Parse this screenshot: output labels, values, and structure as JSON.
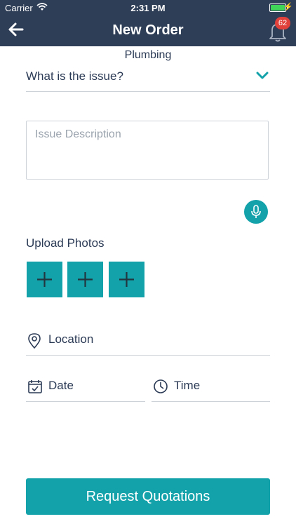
{
  "status_bar": {
    "carrier": "Carrier",
    "time": "2:31 PM"
  },
  "header": {
    "title": "New Order",
    "notification_count": "62",
    "back_icon": "arrow-left-icon",
    "bell_icon": "bell-icon"
  },
  "category": "Plumbing",
  "issue_select": {
    "label": "What is the issue?",
    "icon": "chevron-down-icon"
  },
  "description": {
    "placeholder": "Issue Description",
    "value": ""
  },
  "mic": {
    "icon": "microphone-icon"
  },
  "upload": {
    "title": "Upload Photos",
    "slots": [
      "add-photo-1",
      "add-photo-2",
      "add-photo-3"
    ]
  },
  "location": {
    "label": "Location",
    "icon": "location-pin-icon"
  },
  "date": {
    "label": "Date",
    "icon": "calendar-icon"
  },
  "time": {
    "label": "Time",
    "icon": "clock-icon"
  },
  "cta": {
    "label": "Request Quotations"
  },
  "colors": {
    "header_bg": "#2f3e57",
    "accent": "#13a2aa",
    "badge": "#e0413a",
    "text": "#2b3a55"
  }
}
